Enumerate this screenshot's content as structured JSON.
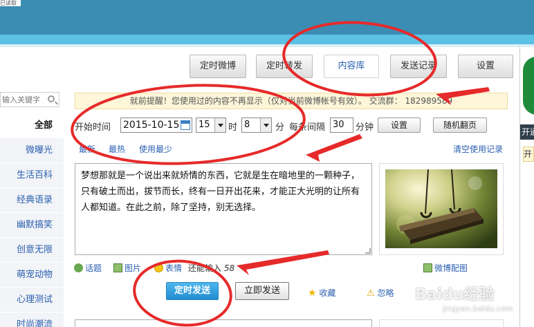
{
  "header": {
    "corner_text": "已读取"
  },
  "tabs": [
    {
      "label": "定时微博"
    },
    {
      "label": "定时转发"
    },
    {
      "label": "内容库"
    },
    {
      "label": "发送记录"
    },
    {
      "label": "设置"
    }
  ],
  "notice": {
    "text": "就前提醒！您使用过的内容不再显示（仅对当前微博帐号有效）。 交流群： 182989589"
  },
  "sidebar": {
    "search_placeholder": "输入关键字",
    "items": [
      {
        "label": "全部"
      },
      {
        "label": "微曝光"
      },
      {
        "label": "生活百科"
      },
      {
        "label": "经典语录"
      },
      {
        "label": "幽默搞笑"
      },
      {
        "label": "创意无限"
      },
      {
        "label": "萌宠动物"
      },
      {
        "label": "心理测试"
      },
      {
        "label": "时尚潮流"
      }
    ]
  },
  "filter": {
    "start_label": "开始时间",
    "date_value": "2015-10-15",
    "hour_value": "15",
    "hour_unit": "时",
    "minute_value": "8",
    "minute_unit": "分",
    "interval_label": "每条间隔",
    "interval_value": "30",
    "interval_unit": "分钟",
    "settings_button": "设置",
    "random_button": "随机翻页"
  },
  "sort": {
    "newest": "最新",
    "hottest": "最热",
    "least_used": "使用最少",
    "clear_history": "清空使用记录"
  },
  "content": {
    "text": "梦想那就是一个说出来就矫情的东西，它就是生在暗地里的一颗种子，只有破土而出，拔节而长，终有一日开出花来，才能正大光明的让所有人都知道。在此之前，除了坚持，别无选择。"
  },
  "tools": {
    "topic": "话题",
    "image": "图片",
    "emoji": "表情",
    "remaining_label": "还能输入",
    "remaining_count": "58",
    "weibo_image": "微博配图"
  },
  "actions": {
    "schedule_send": "定时发送",
    "send_now": "立即发送",
    "favorite": "收藏",
    "ignore": "忽略"
  },
  "right_panel": {
    "tag1": "开通",
    "tag2": "开"
  },
  "watermark": {
    "logo": "Baidu经验",
    "sub": "jingyan.baidu.com"
  },
  "colors": {
    "topbar": "#3b8db3",
    "stripe": "#5bc1e5",
    "link": "#2a5fb0",
    "accent_blue": "#1f8cd1",
    "annotation_red": "#e62a2a"
  }
}
